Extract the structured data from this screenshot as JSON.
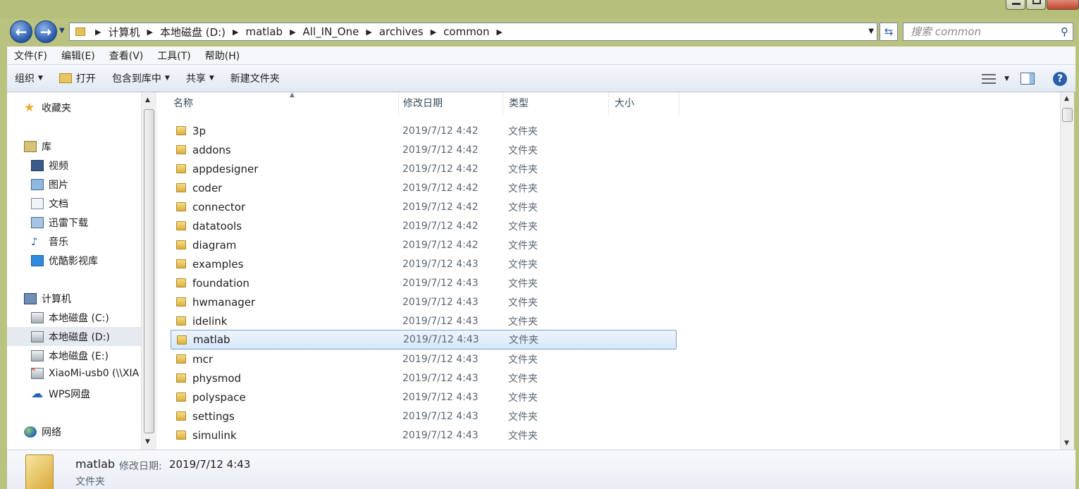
{
  "address": {
    "crumbs": [
      "计算机",
      "本地磁盘 (D:)",
      "matlab",
      "All_IN_One",
      "archives",
      "common"
    ]
  },
  "search": {
    "placeholder": "搜索 common"
  },
  "menu": [
    "文件(F)",
    "编辑(E)",
    "查看(V)",
    "工具(T)",
    "帮助(H)"
  ],
  "toolbar": {
    "organize": "组织",
    "open": "打开",
    "include_library": "包含到库中",
    "share": "共享",
    "new_folder": "新建文件夹"
  },
  "nav": {
    "favorites": "收藏夹",
    "libraries": "库",
    "lib_items": [
      "视频",
      "图片",
      "文档",
      "迅雷下载",
      "音乐",
      "优酷影视库"
    ],
    "computer": "计算机",
    "drives": [
      "本地磁盘 (C:)",
      "本地磁盘 (D:)",
      "本地磁盘 (E:)",
      "XiaoMi-usb0 (\\\\XIA",
      "WPS网盘"
    ],
    "network": "网络"
  },
  "columns": {
    "name": "名称",
    "date": "修改日期",
    "type": "类型",
    "size": "大小"
  },
  "files": [
    {
      "name": "3p",
      "date": "2019/7/12 4:42",
      "type": "文件夹"
    },
    {
      "name": "addons",
      "date": "2019/7/12 4:42",
      "type": "文件夹"
    },
    {
      "name": "appdesigner",
      "date": "2019/7/12 4:42",
      "type": "文件夹"
    },
    {
      "name": "coder",
      "date": "2019/7/12 4:42",
      "type": "文件夹"
    },
    {
      "name": "connector",
      "date": "2019/7/12 4:42",
      "type": "文件夹"
    },
    {
      "name": "datatools",
      "date": "2019/7/12 4:42",
      "type": "文件夹"
    },
    {
      "name": "diagram",
      "date": "2019/7/12 4:42",
      "type": "文件夹"
    },
    {
      "name": "examples",
      "date": "2019/7/12 4:43",
      "type": "文件夹"
    },
    {
      "name": "foundation",
      "date": "2019/7/12 4:43",
      "type": "文件夹"
    },
    {
      "name": "hwmanager",
      "date": "2019/7/12 4:43",
      "type": "文件夹"
    },
    {
      "name": "idelink",
      "date": "2019/7/12 4:43",
      "type": "文件夹"
    },
    {
      "name": "matlab",
      "date": "2019/7/12 4:43",
      "type": "文件夹"
    },
    {
      "name": "mcr",
      "date": "2019/7/12 4:43",
      "type": "文件夹"
    },
    {
      "name": "physmod",
      "date": "2019/7/12 4:43",
      "type": "文件夹"
    },
    {
      "name": "polyspace",
      "date": "2019/7/12 4:43",
      "type": "文件夹"
    },
    {
      "name": "settings",
      "date": "2019/7/12 4:43",
      "type": "文件夹"
    },
    {
      "name": "simulink",
      "date": "2019/7/12 4:43",
      "type": "文件夹"
    }
  ],
  "details": {
    "name": "matlab",
    "date_label": "修改日期:",
    "date": "2019/7/12 4:43",
    "type": "文件夹"
  }
}
